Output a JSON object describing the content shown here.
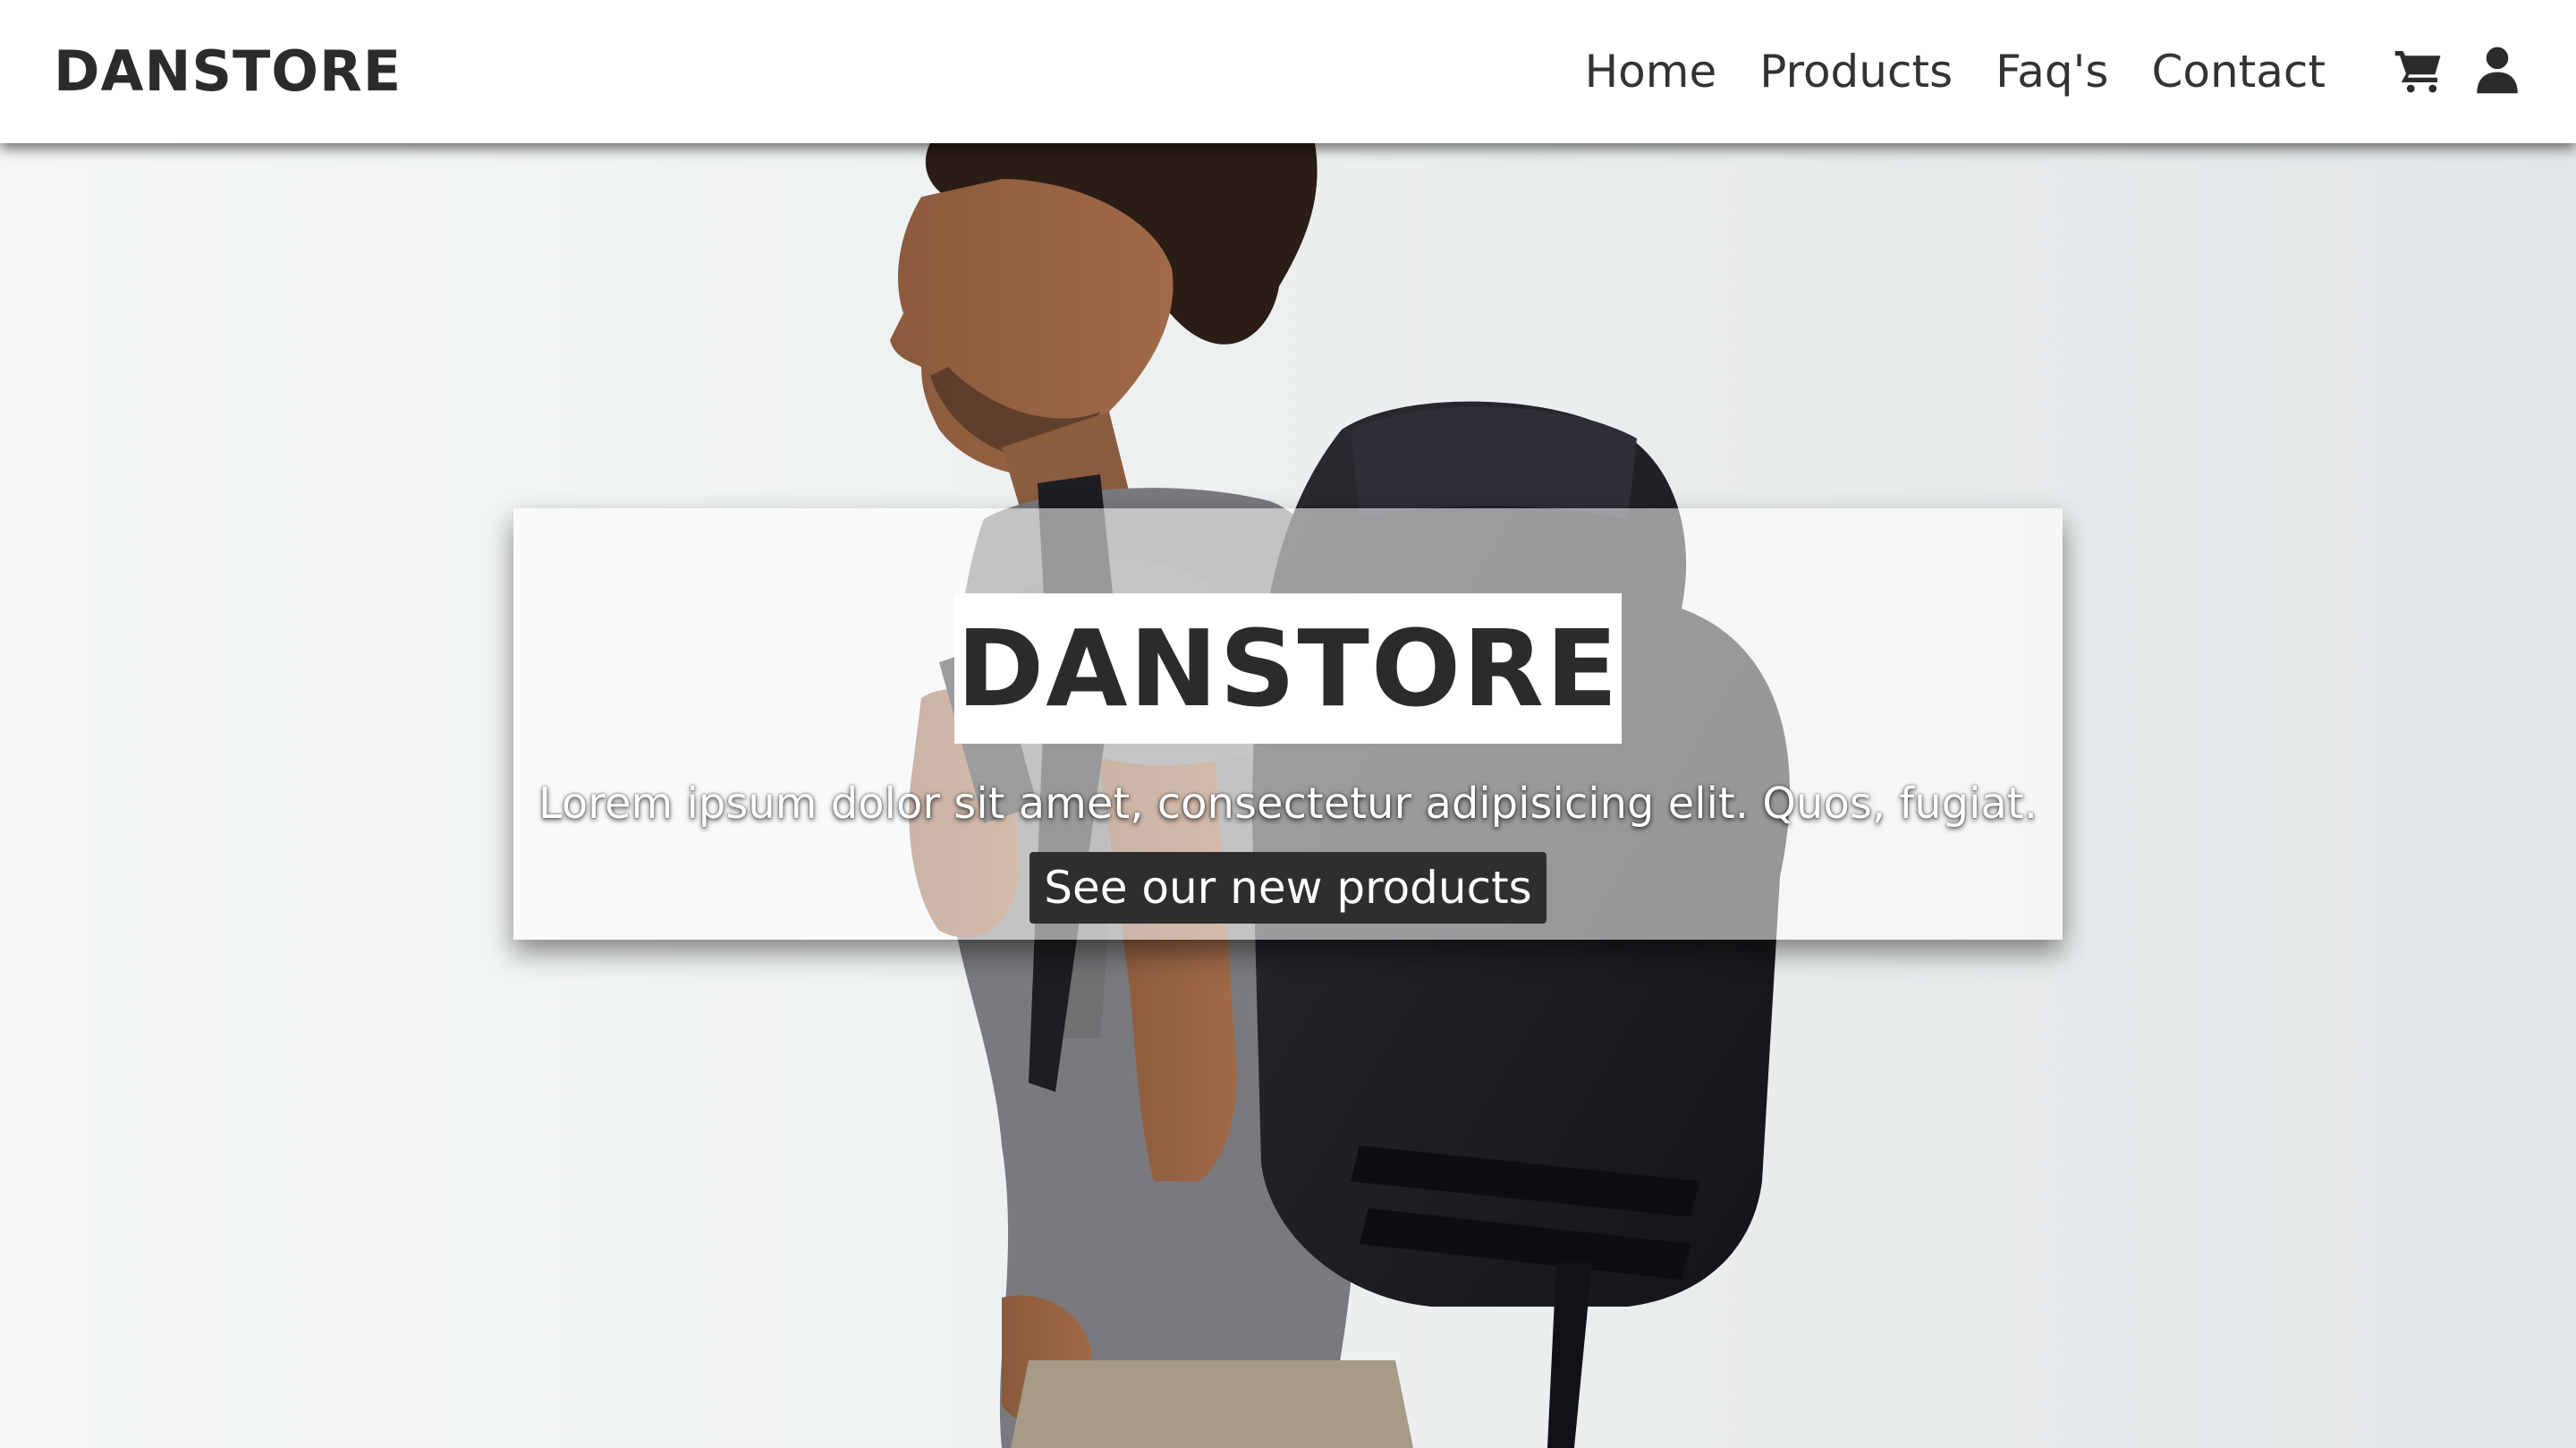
{
  "navbar": {
    "brand": "DANSTORE",
    "links": [
      {
        "label": "Home"
      },
      {
        "label": "Products"
      },
      {
        "label": "Faq's"
      },
      {
        "label": "Contact"
      }
    ],
    "icons": [
      "cart-icon",
      "user-icon"
    ]
  },
  "hero": {
    "title": "DANSTORE",
    "text": "Lorem ipsum dolor sit amet, consectetur adipisicing elit. Quos, fugiat.",
    "button_label": "See our new products",
    "image": "man-with-backpack-photo"
  },
  "colors": {
    "text_dark": "#2b2b2b",
    "button_bg": "#2e2e2e",
    "navbar_bg": "#ffffff"
  }
}
